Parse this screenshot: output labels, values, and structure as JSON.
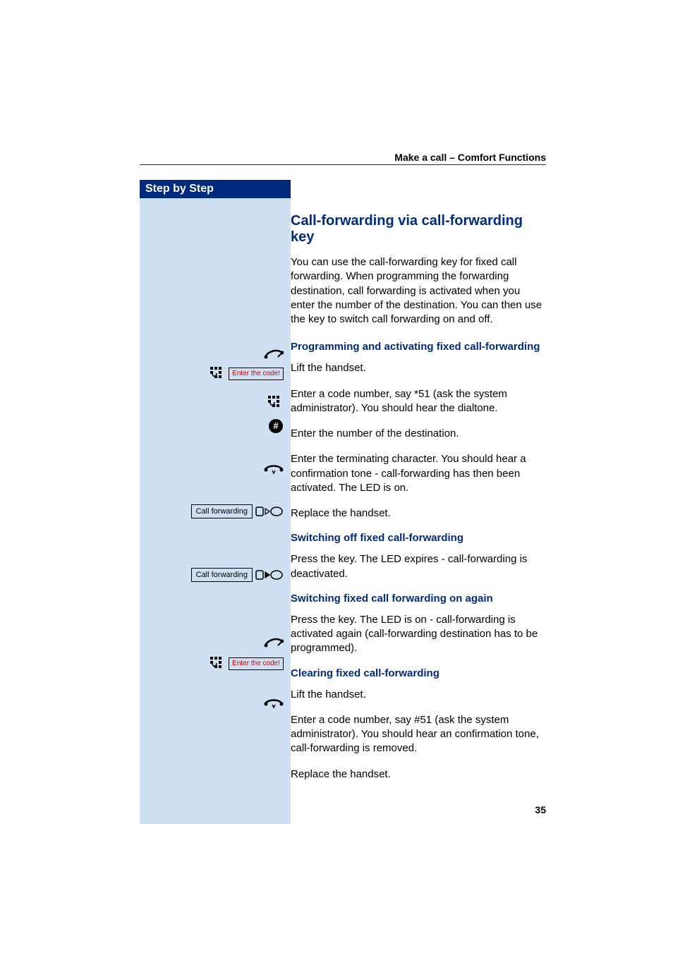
{
  "header": {
    "section": "Make a call – Comfort Functions"
  },
  "sidebar": {
    "title": "Step by Step"
  },
  "content": {
    "title": "Call-forwarding via call-forwarding key",
    "intro": "You can use the call-forwarding key for fixed call forwarding. When programming the forwarding destination, call forwarding is activated when you enter the number of the destination. You can then use the key to switch call forwarding on and off.",
    "sub1": "Programming and activating fixed call-forwarding",
    "s1": "Lift the handset.",
    "s2": "Enter a code number, say *51 (ask the system administrator). You should hear the dialtone.",
    "s3": "Enter the number of the destination.",
    "s4": "Enter the terminating character. You should hear a confirmation tone - call-forwarding has then been activated. The LED is on.",
    "s5": "Replace the handset.",
    "sub2": "Switching off fixed call-forwarding",
    "s6": "Press the key. The LED expires - call-forwarding is deactivated.",
    "sub3": "Switching fixed call forwarding on again",
    "s7": "Press the key. The LED is on - call-forwarding is activated again (call-forwarding destination has to be programmed).",
    "sub4": "Clearing fixed call-forwarding",
    "s8": "Lift the handset.",
    "s9": "Enter a code number, say #51 (ask the system administrator). You should hear an confirmation tone, call-forwarding is removed.",
    "s10": "Replace the handset."
  },
  "icons": {
    "enter_code": "Enter the code!",
    "call_forwarding": "Call forwarding"
  },
  "page_number": "35"
}
